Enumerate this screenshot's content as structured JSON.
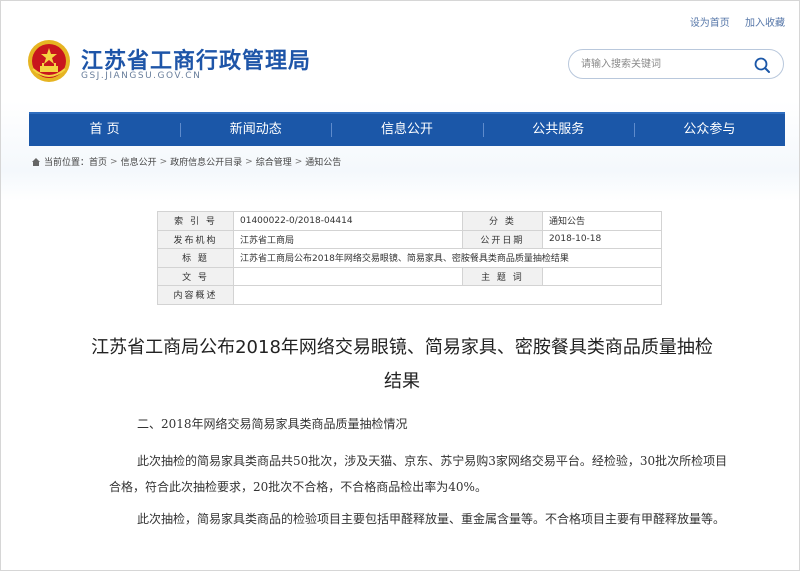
{
  "top_links": [
    "设为首页",
    "加入收藏"
  ],
  "site": {
    "title": "江苏省工商行政管理局",
    "domain": "GSJ.JIANGSU.GOV.CN"
  },
  "search": {
    "placeholder": "请输入搜索关键词",
    "icon": "search-icon"
  },
  "nav": [
    "首 页",
    "新闻动态",
    "信息公开",
    "公共服务",
    "公众参与"
  ],
  "breadcrumb": {
    "prefix": "当前位置：",
    "items": [
      "首页",
      "信息公开",
      "政府信息公开目录",
      "综合管理",
      "通知公告"
    ],
    "separator": ">"
  },
  "meta_table": {
    "index_label": "索 引 号",
    "index_value": "01400022-0/2018-04414",
    "category_label": "分 类",
    "category_value": "通知公告",
    "publisher_label": "发布机构",
    "publisher_value": "江苏省工商局",
    "date_label": "公开日期",
    "date_value": "2018-10-18",
    "title_label": "标 题",
    "title_value": "江苏省工商局公布2018年网络交易眼镜、简易家具、密胺餐具类商品质量抽检结果",
    "doc_label": "文 号",
    "doc_value": "",
    "subject_label": "主 题 词",
    "subject_value": "",
    "summary_label": "内容概述",
    "summary_value": ""
  },
  "article": {
    "title": "江苏省工商局公布2018年网络交易眼镜、简易家具、密胺餐具类商品质量抽检结果",
    "section_heading": "二、2018年网络交易简易家具类商品质量抽检情况",
    "paragraph1": "此次抽检的简易家具类商品共50批次，涉及天猫、京东、苏宁易购3家网络交易平台。经检验，30批次所检项目合格，符合此次抽检要求，20批次不合格，不合格商品检出率为40%。",
    "paragraph2": "此次抽检，简易家具类商品的检验项目主要包括甲醛释放量、重金属含量等。不合格项目主要有甲醛释放量等。"
  },
  "colors": {
    "nav_bg": "#1b57a8",
    "title_blue": "#1e55a8",
    "emblem_red": "#c8161d",
    "emblem_gold": "#e6b422"
  }
}
